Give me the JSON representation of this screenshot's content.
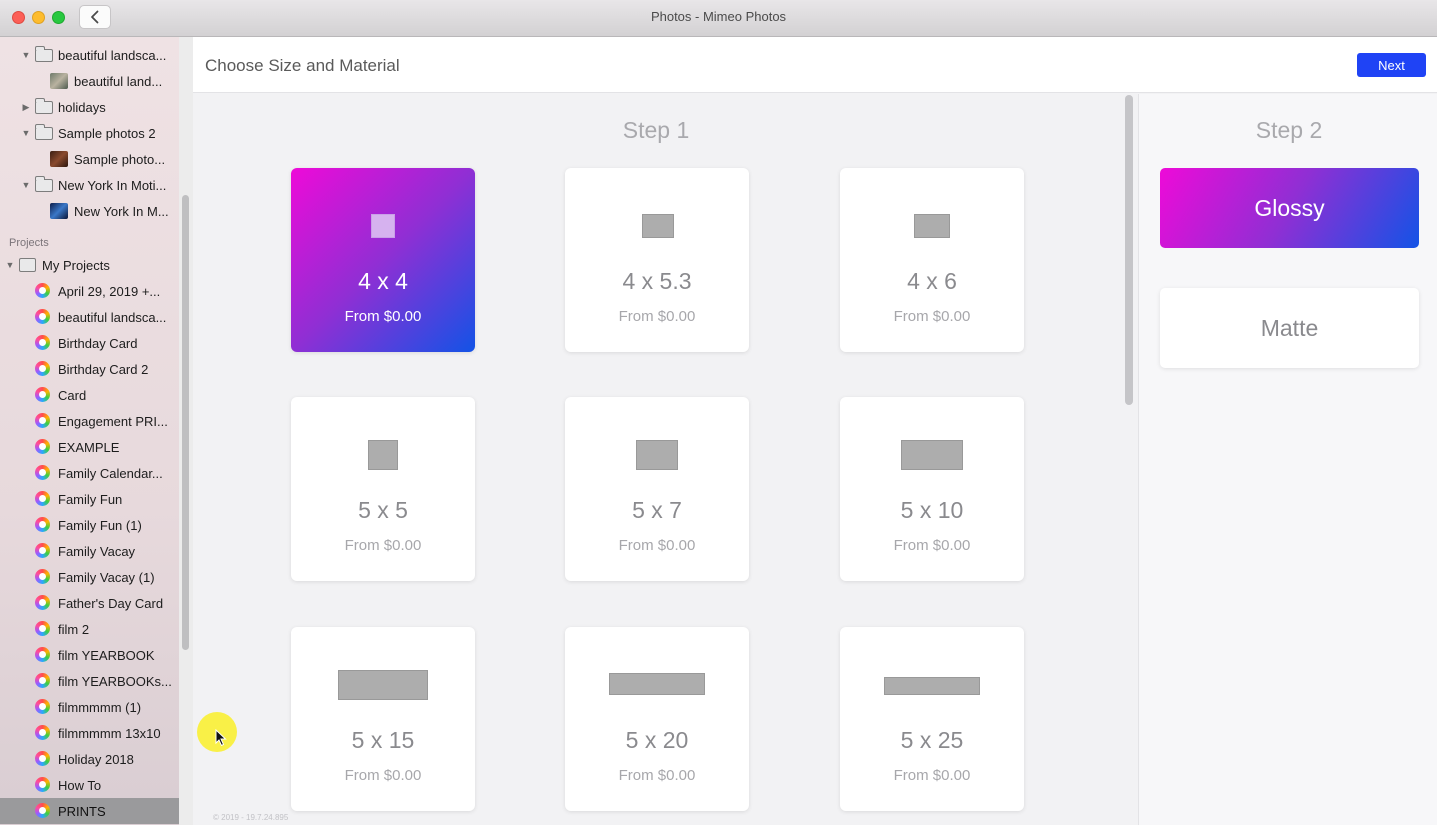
{
  "window": {
    "title": "Photos - Mimeo Photos"
  },
  "sidebar": {
    "tree": [
      {
        "label": "beautiful landsca...",
        "kind": "folder",
        "expanded": true
      },
      {
        "label": "beautiful land...",
        "kind": "thumb-land"
      },
      {
        "label": "holidays",
        "kind": "folder",
        "expanded": false
      },
      {
        "label": "Sample photos 2",
        "kind": "folder",
        "expanded": true
      },
      {
        "label": "Sample photo...",
        "kind": "thumb-sample"
      },
      {
        "label": "New York In Moti...",
        "kind": "folder",
        "expanded": true
      },
      {
        "label": "New York In M...",
        "kind": "thumb-ny"
      }
    ],
    "projects_header": "Projects",
    "my_projects": "My Projects",
    "projects": [
      "April 29, 2019 +...",
      "beautiful landsca...",
      "Birthday Card",
      "Birthday Card 2",
      "Card",
      "Engagement PRI...",
      "EXAMPLE",
      "Family Calendar...",
      "Family Fun",
      "Family Fun (1)",
      "Family Vacay",
      "Family Vacay (1)",
      "Father's Day Card",
      "film 2",
      "film YEARBOOK",
      "film YEARBOOKs...",
      "filmmmmm (1)",
      "filmmmmm 13x10",
      "Holiday 2018",
      "How To",
      "PRINTS"
    ],
    "selected_project": "PRINTS"
  },
  "header": {
    "title": "Choose Size and Material",
    "next_label": "Next"
  },
  "step1": {
    "title": "Step 1",
    "sizes": [
      {
        "size": "4 x 4",
        "price": "From $0.00",
        "selected": true
      },
      {
        "size": "4 x 5.3",
        "price": "From $0.00",
        "selected": false
      },
      {
        "size": "4 x 6",
        "price": "From $0.00",
        "selected": false
      },
      {
        "size": "5 x 5",
        "price": "From $0.00",
        "selected": false
      },
      {
        "size": "5 x 7",
        "price": "From $0.00",
        "selected": false
      },
      {
        "size": "5 x 10",
        "price": "From $0.00",
        "selected": false
      },
      {
        "size": "5 x 15",
        "price": "From $0.00",
        "selected": false
      },
      {
        "size": "5 x 20",
        "price": "From $0.00",
        "selected": false
      },
      {
        "size": "5 x 25",
        "price": "From $0.00",
        "selected": false
      }
    ]
  },
  "step2": {
    "title": "Step 2",
    "materials": [
      {
        "label": "Glossy",
        "selected": true
      },
      {
        "label": "Matte",
        "selected": false
      }
    ]
  },
  "footer": {
    "copyright": "© 2019 - 19.7.24.895"
  },
  "colors": {
    "accent": "#1f43f5",
    "gradient_start": "#ee0ad8",
    "gradient_end": "#1353e6"
  }
}
